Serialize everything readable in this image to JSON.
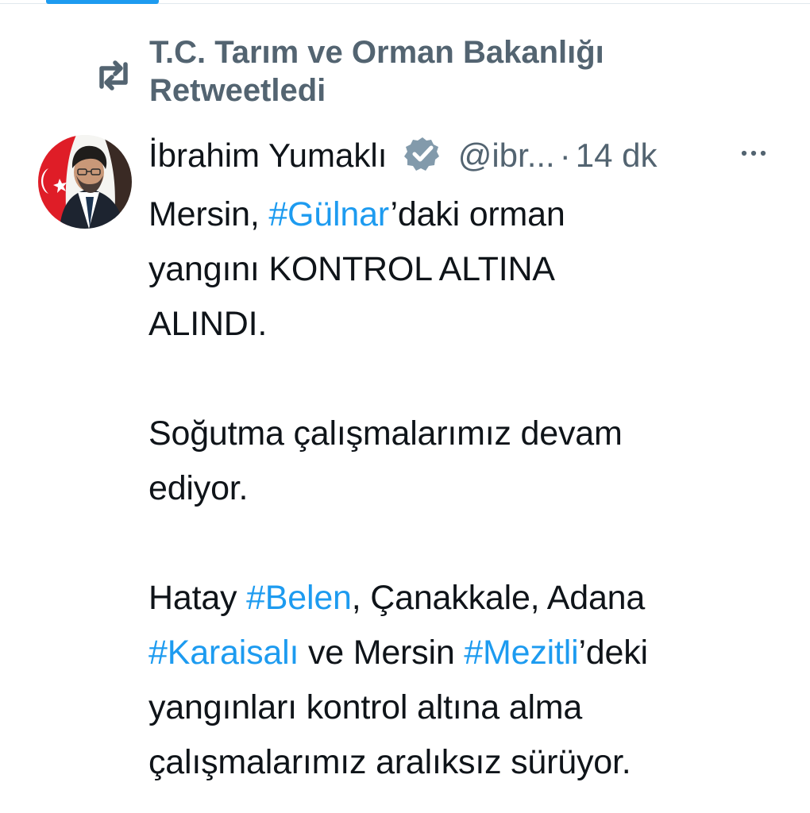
{
  "retweet": {
    "account": "T.C. Tarım ve Orman Bakanlığı",
    "label": "Retweetledi",
    "icon": "retweet-icon"
  },
  "tweet": {
    "author": "İbrahim Yumaklı",
    "verified_icon": "verified-badge-icon",
    "handle": "@ibr...",
    "separator": "·",
    "time": "14 dk",
    "more_icon": "more-options-icon",
    "paragraphs": [
      {
        "lines": [
          [
            {
              "text": "Mersin, "
            },
            {
              "text": "#Gülnar",
              "hashtag": true
            },
            {
              "text": "’daki orman"
            }
          ],
          [
            {
              "text": "yangını KONTROL ALTINA"
            }
          ],
          [
            {
              "text": "ALINDI."
            }
          ]
        ]
      },
      {
        "lines": [
          [
            {
              "text": "Soğutma çalışmalarımız devam"
            }
          ],
          [
            {
              "text": "ediyor."
            }
          ]
        ]
      },
      {
        "lines": [
          [
            {
              "text": "Hatay "
            },
            {
              "text": "#Belen",
              "hashtag": true
            },
            {
              "text": ", Çanakkale, Adana"
            }
          ],
          [
            {
              "text": "#Karaisalı",
              "hashtag": true
            },
            {
              "text": " ve Mersin "
            },
            {
              "text": "#Mezitli",
              "hashtag": true
            },
            {
              "text": "’deki"
            }
          ],
          [
            {
              "text": "yangınları kontrol altına alma"
            }
          ],
          [
            {
              "text": "çalışmalarımız aralıksız sürüyor."
            }
          ]
        ]
      }
    ]
  },
  "colors": {
    "hashtag": "#1d9bf0",
    "secondary_text": "#536471",
    "primary_text": "#0f1419"
  }
}
